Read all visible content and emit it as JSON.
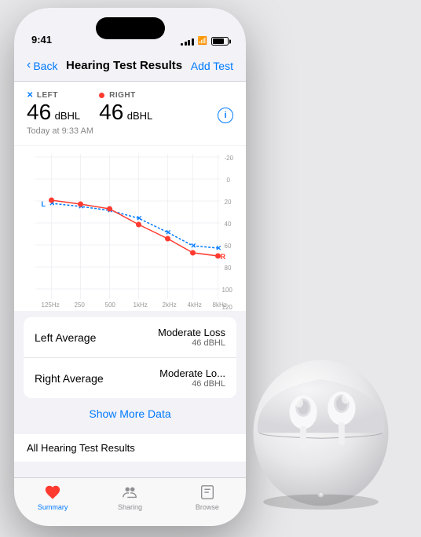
{
  "statusBar": {
    "time": "9:41",
    "signalBars": [
      3,
      5,
      7,
      9,
      11
    ],
    "battery": 75
  },
  "nav": {
    "backLabel": "Back",
    "title": "Hearing Test Results",
    "addLabel": "Add Test"
  },
  "hearing": {
    "leftLabel": "LEFT",
    "rightLabel": "RIGHT",
    "leftValue": "46",
    "rightValue": "46",
    "unit": "dBHL",
    "timestamp": "Today at 9:33 AM"
  },
  "chart": {
    "yLabels": [
      "-20",
      "0",
      "20",
      "40",
      "60",
      "80",
      "100",
      "120"
    ],
    "xLabels": [
      "125Hz",
      "250",
      "500",
      "1kHz",
      "2kHz",
      "4kHz",
      "8kHz"
    ]
  },
  "cards": [
    {
      "label": "Left Average",
      "value": "Moderate Loss",
      "subValue": "46 dBHL"
    },
    {
      "label": "Right Average",
      "value": "Moderate Lo...",
      "subValue": "46 dBHL"
    }
  ],
  "showMore": "Show More Data",
  "allResults": "All Hearing Test Results",
  "tabs": [
    {
      "label": "Summary",
      "active": true
    },
    {
      "label": "Sharing",
      "active": false
    },
    {
      "label": "Browse",
      "active": false
    }
  ]
}
